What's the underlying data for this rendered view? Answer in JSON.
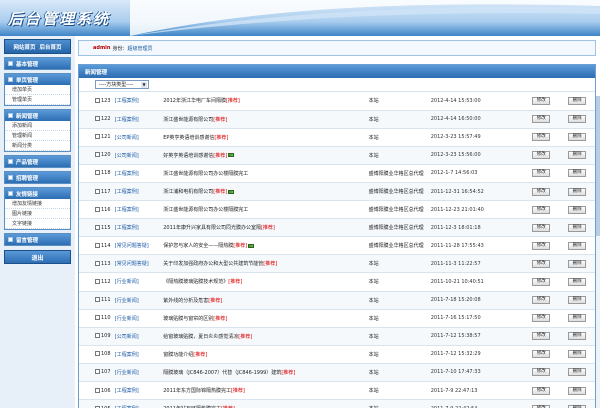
{
  "header": {
    "logo": "后台管理系统"
  },
  "sidebar": {
    "home_links": [
      "网站首页",
      "后台首页"
    ],
    "groups": [
      {
        "title": "基本管理",
        "items": []
      },
      {
        "title": "单页管理",
        "items": [
          "增加单页",
          "管理单页"
        ]
      },
      {
        "title": "新闻管理",
        "items": [
          "添加新闻",
          "管理新闻",
          "新闻分类"
        ]
      },
      {
        "title": "产品管理",
        "items": []
      },
      {
        "title": "招聘管理",
        "items": []
      },
      {
        "title": "友情链接",
        "items": [
          "增加友情链接",
          "图片链接",
          "文字链接"
        ]
      },
      {
        "title": "留言管理",
        "items": []
      }
    ],
    "logout": "退出"
  },
  "status": {
    "user": "admin",
    "label": "身份：",
    "role": "超级管理员"
  },
  "panel": {
    "title": "新闻管理",
    "filter_placeholder": "----方块类型----"
  },
  "news": [
    {
      "id": "123",
      "cat": "[工程案例]",
      "title": "2012年浙江华电厂车间隔膜",
      "hot": "[推荐]",
      "img": false,
      "src": "本站",
      "time": "2012-4-14 15:53:00",
      "edit": "修改",
      "del": "删除"
    },
    {
      "id": "122",
      "cat": "[工程案例]",
      "title": "浙江盛世能源有限公司",
      "hot": "[推荐]",
      "img": false,
      "src": "本站",
      "time": "2012-4-14 16:50:00",
      "edit": "修改",
      "del": "删除"
    },
    {
      "id": "121",
      "cat": "[公司新闻]",
      "title": "EP英亨英语培训感谢信",
      "hot": "[推荐]",
      "img": false,
      "src": "本站",
      "time": "2012-3-23 15:57:49",
      "edit": "修改",
      "del": "删除"
    },
    {
      "id": "120",
      "cat": "[公司新闻]",
      "title": "好英亨英语培训感谢信",
      "hot": "[推荐]",
      "img": true,
      "src": "本站",
      "time": "2012-3-23 15:56:00",
      "edit": "修改",
      "del": "删除"
    },
    {
      "id": "118",
      "cat": "[工程案例]",
      "title": "浙江盛世能源有限公司办公楼隔膜完工",
      "hot": "",
      "img": false,
      "src": "盛博阳膜业华格区总代理",
      "time": "2012-1-7 14:56:03",
      "edit": "修改",
      "del": "删除"
    },
    {
      "id": "117",
      "cat": "[工程案例]",
      "title": "浙江浦和电机有限公司",
      "hot": "[推荐]",
      "img": true,
      "src": "盛博阳膜业华格区总代理",
      "time": "2011-12-31 16:54:52",
      "edit": "修改",
      "del": "删除"
    },
    {
      "id": "116",
      "cat": "[工程案例]",
      "title": "浙江盛世能源有限公司办公楼隔膜完工",
      "hot": "",
      "img": false,
      "src": "盛博阳膜业华格区总代理",
      "time": "2011-12-23 21:01:40",
      "edit": "修改",
      "del": "删除"
    },
    {
      "id": "115",
      "cat": "[工程案例]",
      "title": "2011年康升兴家具有限公司同光膜办公室隔",
      "hot": "[推荐]",
      "img": false,
      "src": "盛博阳膜业华格区总代理",
      "time": "2011-12-3 18:01:18",
      "edit": "修改",
      "del": "删除"
    },
    {
      "id": "114",
      "cat": "[常见问题答疑]",
      "title": "保护您与家人的安全——隔热膜",
      "hot": "[推荐]",
      "img": true,
      "src": "盛博阳膜业华格区总代理",
      "time": "2011-11-28 17:55:43",
      "edit": "修改",
      "del": "删除"
    },
    {
      "id": "113",
      "cat": "[常见问题答疑]",
      "title": "关于印发加强政府办公和大型公共建筑节能管",
      "hot": "[推荐]",
      "img": false,
      "src": "本站",
      "time": "2011-11-3 11:22:57",
      "edit": "修改",
      "del": "删除"
    },
    {
      "id": "112",
      "cat": "[行业新闻]",
      "title": "《隔热膜玻璃贴膜技术规范》",
      "hot": "[推荐]",
      "img": false,
      "src": "本站",
      "time": "2011-10-21 10:40:51",
      "edit": "修改",
      "del": "删除"
    },
    {
      "id": "111",
      "cat": "[行业新闻]",
      "title": "紫外线的分析及危害",
      "hot": "[推荐]",
      "img": false,
      "src": "本站",
      "time": "2011-7-18 15:20:08",
      "edit": "修改",
      "del": "删除"
    },
    {
      "id": "110",
      "cat": "[行业新闻]",
      "title": "玻璃贴膜与窗帘的区别",
      "hot": "[推荐]",
      "img": false,
      "src": "本站",
      "time": "2011-7-16 15:17:50",
      "edit": "修改",
      "del": "删除"
    },
    {
      "id": "109",
      "cat": "[公司新闻]",
      "title": "给窗玻璃贴膜，夏日炎炎感觉清凉",
      "hot": "[推荐]",
      "img": false,
      "src": "本站",
      "time": "2011-7-12 15:38:57",
      "edit": "修改",
      "del": "删除"
    },
    {
      "id": "108",
      "cat": "[工程案例]",
      "title": "窗膜功能介绍",
      "hot": "[推荐]",
      "img": false,
      "src": "本站",
      "time": "2011-7-12 15:32:29",
      "edit": "修改",
      "del": "删除"
    },
    {
      "id": "107",
      "cat": "[行业新闻]",
      "title": "隔膜玻璃（JC846-2007）代替（JC846-1999）建筑",
      "hot": "[推荐]",
      "img": false,
      "src": "本站",
      "time": "2011-7-10 17:47:33",
      "edit": "修改",
      "del": "删除"
    },
    {
      "id": "106",
      "cat": "[工程案例]",
      "title": "2011年东方国际锦隔热膜完工",
      "hot": "[推荐]",
      "img": false,
      "src": "本站",
      "time": "2011-7-9 22:47:13",
      "edit": "修改",
      "del": "删除"
    },
    {
      "id": "105",
      "cat": "[工程案例]",
      "title": "2011年钻石环隔热膜完工",
      "hot": "[推荐]",
      "img": false,
      "src": "本站",
      "time": "2011-7-9 22:42:54",
      "edit": "修改",
      "del": "删除"
    }
  ]
}
